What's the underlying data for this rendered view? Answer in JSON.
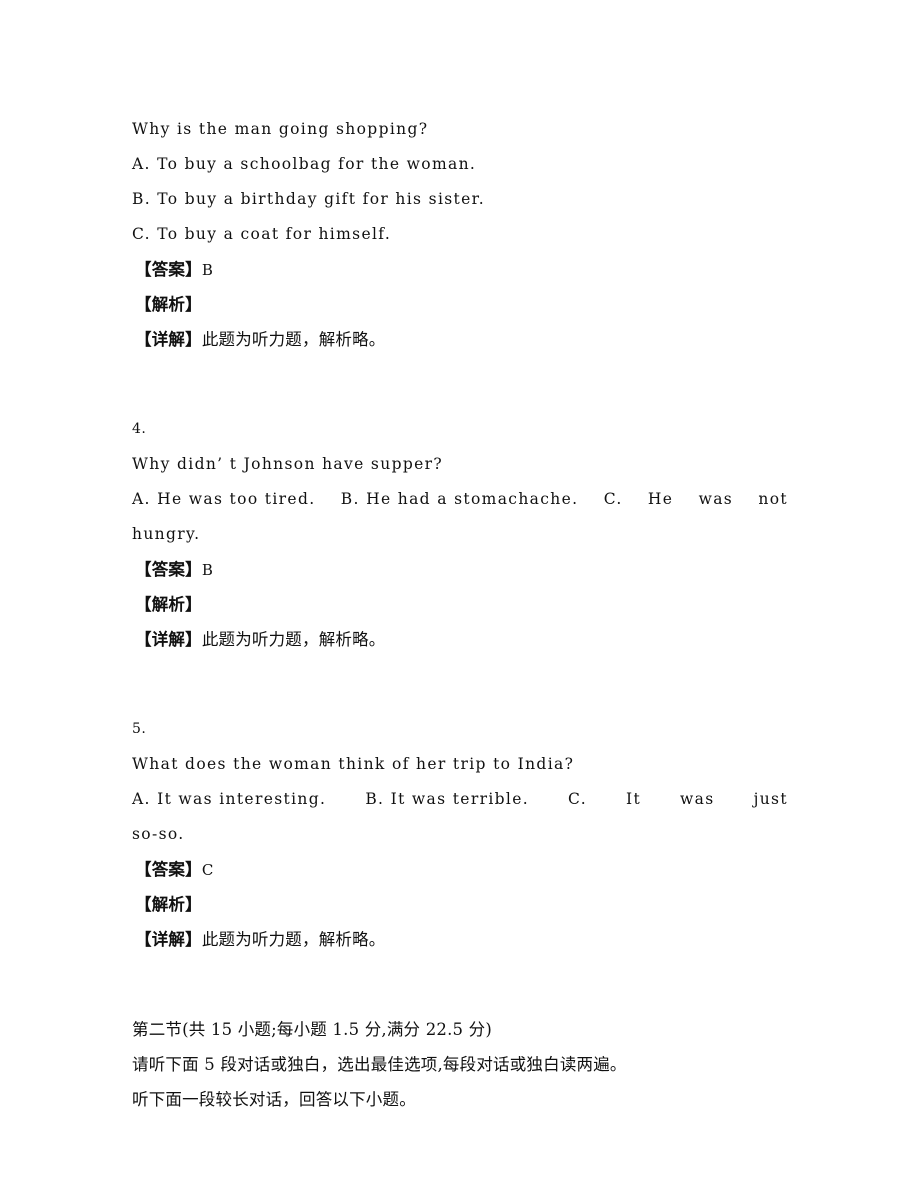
{
  "document": {
    "page_background": "#ffffff",
    "text_color": "#111111",
    "language": "zh-CN + en"
  },
  "question_3": {
    "stem": "Why is the man going shopping?",
    "options": [
      "A. To buy a schoolbag for the woman.",
      "B. To buy a birthday gift for his sister.",
      "C. To buy a coat for himself."
    ],
    "answer_tag": "【答案】",
    "answer_value": "B",
    "analysis_tag": "【解析】",
    "analysis_value": "",
    "detail_tag": "【详解】",
    "detail_value": "此题为听力题，解析略。"
  },
  "question_4": {
    "number": "4.",
    "stem": "Why didn’ t Johnson have supper?",
    "option_a": "A. He was too tired.",
    "option_b": "B. He had a stomachache.",
    "option_c_letter": "C.",
    "option_c_w1": "He",
    "option_c_w2": "was",
    "option_c_w3": "not",
    "option_c_wrap": "hungry.",
    "answer_tag": "【答案】",
    "answer_value": "B",
    "analysis_tag": "【解析】",
    "analysis_value": "",
    "detail_tag": "【详解】",
    "detail_value": "此题为听力题，解析略。"
  },
  "question_5": {
    "number": "5.",
    "stem": "What does the woman think of her trip to India?",
    "option_a": "A. It was interesting.",
    "option_b": "B. It was terrible.",
    "option_c_letter": "C.",
    "option_c_w1": "It",
    "option_c_w2": "was",
    "option_c_w3": "just",
    "option_c_wrap": "so-so.",
    "answer_tag": "【答案】",
    "answer_value": "C",
    "analysis_tag": "【解析】",
    "analysis_value": "",
    "detail_tag": "【详解】",
    "detail_value": "此题为听力题，解析略。"
  },
  "section_two": {
    "heading": "第二节(共 15 小题;每小题 1.5 分,满分 22.5 分)",
    "instruction": "请听下面 5 段对话或独白，选出最佳选项,每段对话或独白读两遍。",
    "sub_instruction": "听下面一段较长对话，回答以下小题。"
  }
}
